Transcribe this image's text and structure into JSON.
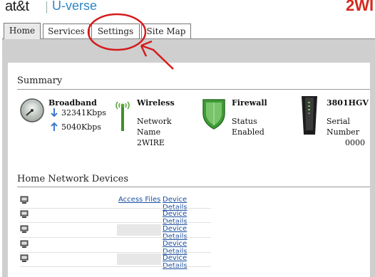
{
  "header": {
    "brand": "at&t",
    "product": "U-verse",
    "brand_right": "2WI"
  },
  "tabs": [
    {
      "label": "Home"
    },
    {
      "label": "Services"
    },
    {
      "label": "Settings"
    },
    {
      "label": "Site Map"
    }
  ],
  "summary": {
    "title": "Summary",
    "broadband": {
      "label": "Broadband",
      "down": "32341Kbps",
      "up": "5040Kbps"
    },
    "wireless": {
      "label": "Wireless",
      "network_label": "Network",
      "name_label": "Name",
      "network_name": "2WIRE"
    },
    "firewall": {
      "label": "Firewall",
      "status_label": "Status",
      "status_value": "Enabled"
    },
    "gateway": {
      "label": "3801HGV",
      "serial_label": "Serial",
      "number_label": "Number",
      "serial_value": "0000"
    }
  },
  "devices": {
    "title": "Home Network Devices",
    "access_files": "Access Files",
    "device_details": "Device Details"
  },
  "colors": {
    "tab_bg": "#e9e9e9",
    "frame_gray": "#cfcfcf",
    "link": "#1a4fa0",
    "annotation": "#d41c1c",
    "uverse_blue": "#2f86c3",
    "brand_red": "#d52a1e"
  }
}
